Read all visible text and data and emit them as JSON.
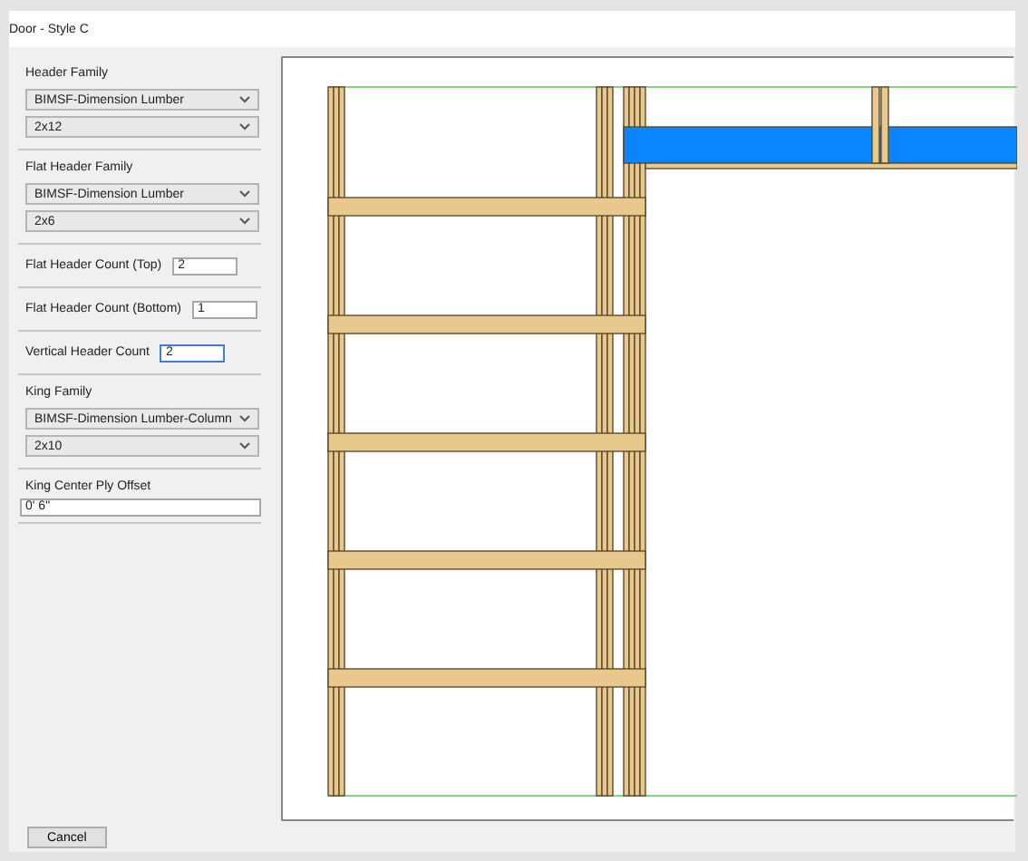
{
  "window": {
    "title": "Door - Style C"
  },
  "sections": [
    {
      "kind": "family",
      "label": "Header Family",
      "dropdowns": [
        "BIMSF-Dimension Lumber",
        "2x12"
      ]
    },
    {
      "kind": "family",
      "label": "Flat Header Family",
      "dropdowns": [
        "BIMSF-Dimension Lumber",
        "2x6"
      ]
    },
    {
      "kind": "count",
      "label": "Flat Header Count (Top)",
      "value": "2",
      "focused": false
    },
    {
      "kind": "count",
      "label": "Flat Header Count (Bottom)",
      "value": "1",
      "focused": false
    },
    {
      "kind": "count",
      "label": "Vertical Header Count",
      "value": "2",
      "focused": true
    },
    {
      "kind": "family",
      "label": "King Family",
      "dropdowns": [
        "BIMSF-Dimension Lumber-Column",
        "2x10"
      ]
    },
    {
      "kind": "text",
      "label": "King Center Ply Offset",
      "value": "0' 6\""
    }
  ],
  "buttons": [
    "Cancel"
  ]
}
